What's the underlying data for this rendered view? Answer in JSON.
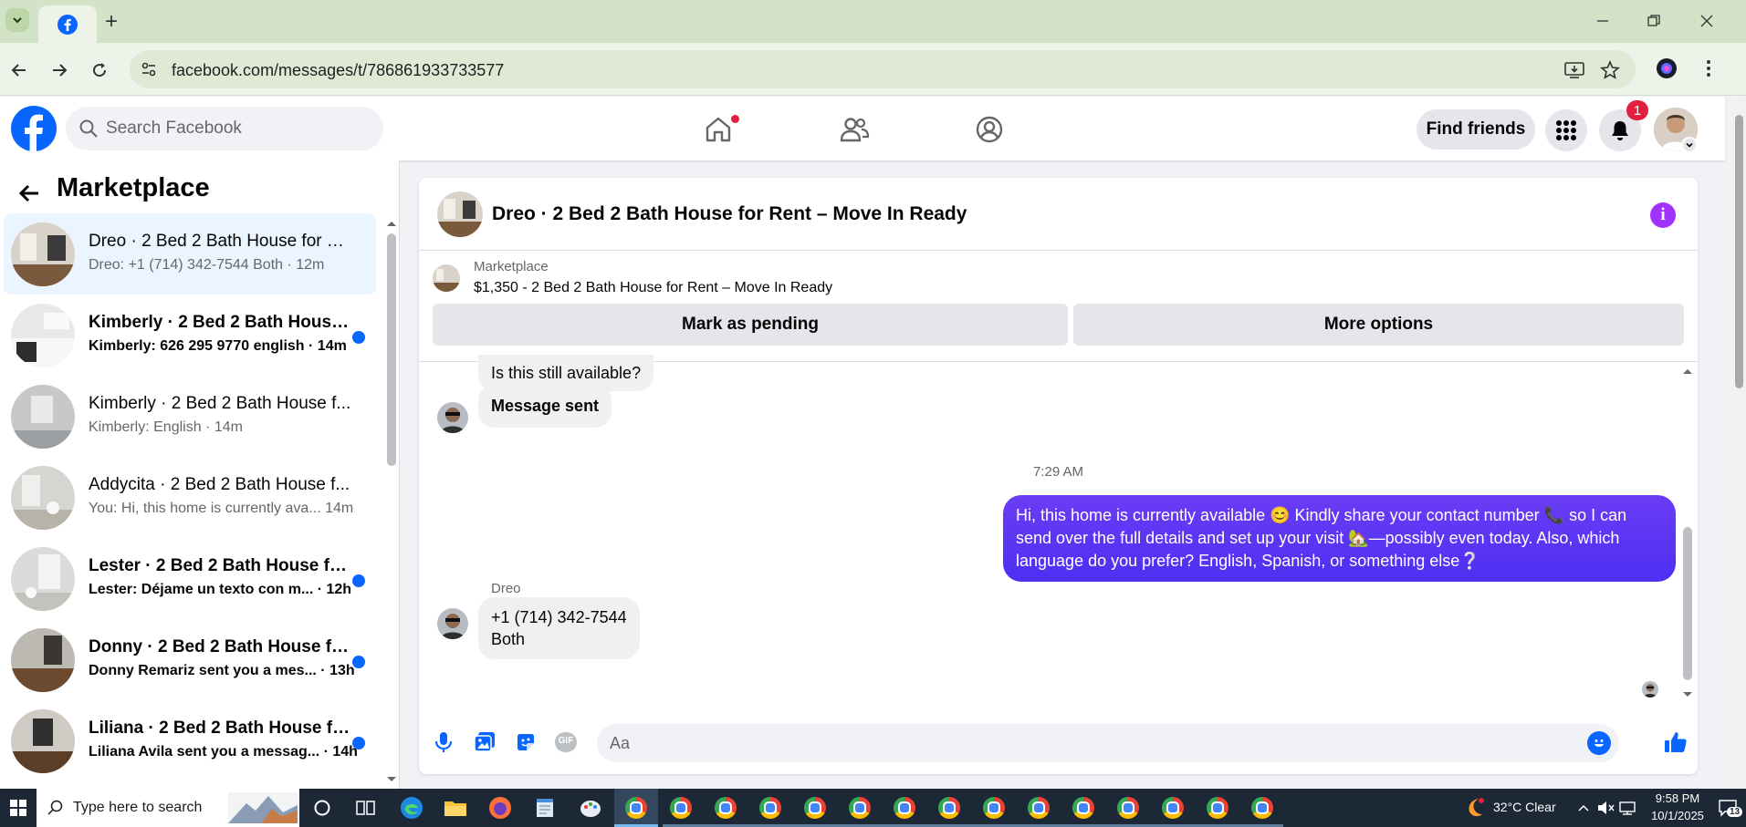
{
  "browser": {
    "url": "facebook.com/messages/t/786861933733577"
  },
  "header": {
    "search_placeholder": "Search Facebook",
    "find_friends_label": "Find friends",
    "notification_count": "1"
  },
  "left_panel": {
    "title": "Marketplace",
    "conversations": [
      {
        "name": "Dreo · 2 Bed 2 Bath House for R...",
        "preview": "Dreo: +1 (714) 342-7544 Both · 12m",
        "unread": false,
        "active": true
      },
      {
        "name": "Kimberly · 2 Bed 2 Bath House...",
        "preview": "Kimberly: 626 295 9770 english · 14m",
        "unread": true,
        "active": false
      },
      {
        "name": "Kimberly · 2 Bed 2 Bath House f...",
        "preview": "Kimberly: English · 14m",
        "unread": false,
        "active": false
      },
      {
        "name": "Addycita · 2 Bed 2 Bath House f...",
        "preview": "You: Hi, this home is currently ava... 14m",
        "unread": false,
        "active": false
      },
      {
        "name": "Lester · 2 Bed 2 Bath House fo...",
        "preview": "Lester: Déjame un texto con m... · 12h",
        "unread": true,
        "active": false
      },
      {
        "name": "Donny · 2 Bed 2 Bath House fo...",
        "preview": "Donny Remariz sent you a mes... · 13h",
        "unread": true,
        "active": false
      },
      {
        "name": "Liliana · 2 Bed 2 Bath House fo...",
        "preview": "Liliana Avila sent you a messag... · 14h",
        "unread": true,
        "active": false
      }
    ]
  },
  "chat": {
    "title": "Dreo · 2 Bed 2 Bath House for Rent – Move In Ready",
    "marketplace_label": "Marketplace",
    "listing": "$1,350 - 2 Bed 2 Bath House for Rent – Move In Ready",
    "mark_pending_label": "Mark as pending",
    "more_options_label": "More options",
    "messages": {
      "msg1": "Is this still available?",
      "msg2": "Message sent",
      "timestamp": "7:29 AM",
      "outgoing": "Hi, this home is currently available 😊 Kindly share your contact number 📞 so I can send over the full details and set up your visit 🏡—possibly even today. Also, which language do you prefer? English, Spanish, or something else❔",
      "sender_label": "Dreo",
      "reply_line1": "+1 (714) 342-7544",
      "reply_line2": "Both"
    },
    "composer_placeholder": "Aa",
    "gif_label": "GIF"
  },
  "taskbar": {
    "search_placeholder": "Type here to search",
    "weather": "32°C  Clear",
    "time": "9:58 PM",
    "date": "10/1/2025",
    "notification_count": "13"
  }
}
